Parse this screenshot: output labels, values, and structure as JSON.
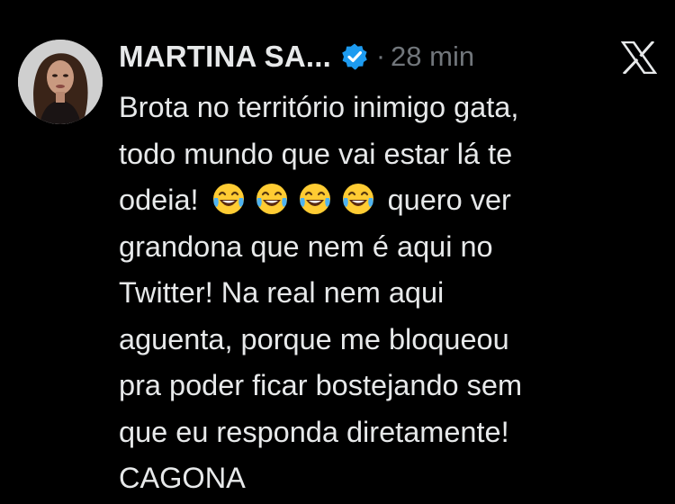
{
  "tweet": {
    "author_name": "MARTINA SA...",
    "separator": "·",
    "timestamp": "28 min",
    "verified": true,
    "platform_icon": "x-logo-icon",
    "lines": {
      "l1": "Brota no território inimigo gata,",
      "l2": "todo mundo que vai estar lá te",
      "l3_before": "odeia!",
      "l3_after": "quero ver",
      "l4": "grandona que nem é aqui no",
      "l5": "Twitter! Na real nem aqui",
      "l6": "aguenta, porque me bloqueou",
      "l7": "pra poder ficar bostejando sem",
      "l8": "que eu responda diretamente!",
      "l9": "CAGONA"
    },
    "emoji": {
      "name": "face-with-tears-of-joy-icon",
      "count": 4
    }
  },
  "colors": {
    "background": "#000000",
    "text": "#e7e9ea",
    "muted": "#71767b",
    "verified": "#1d9bf0",
    "emoji_face": "#ffcc33"
  }
}
